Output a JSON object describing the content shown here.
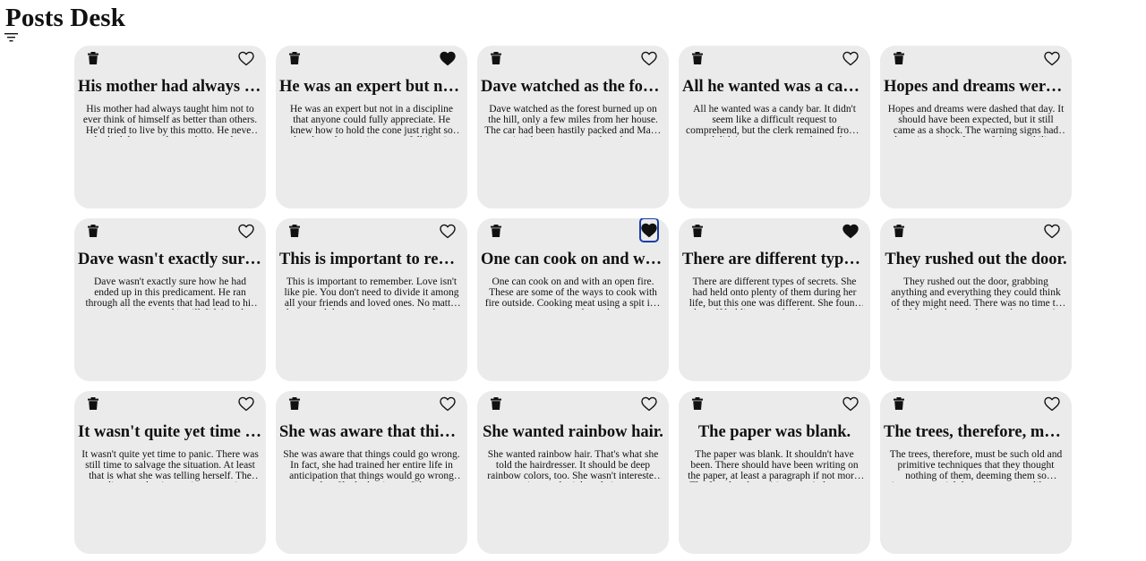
{
  "app": {
    "title": "Posts Desk"
  },
  "toolbar": {
    "filter_icon": "filter-icon"
  },
  "posts": [
    {
      "title": "His mother had always taught him",
      "body": "His mother had always taught him not to ever think of himself as better than others. He'd tried to live by this motto. He never looked down on those who were less fortunate.",
      "liked": false
    },
    {
      "title": "He was an expert but not in a discipline",
      "body": "He was an expert but not in a discipline that anyone could fully appreciate. He knew how to hold the cone just right so that the soft serve ice cream fell into it.",
      "liked": true
    },
    {
      "title": "Dave watched as the forest burned up",
      "body": "Dave watched as the forest burned up on the hill, only a few miles from her house. The car had been hastily packed and Marta was inside trying to round up the pets.",
      "liked": false
    },
    {
      "title": "All he wanted was a candy bar.",
      "body": "All he wanted was a candy bar. It didn't seem like a difficult request to comprehend, but the clerk remained frozen and didn't seem to want to honor the request.",
      "liked": false
    },
    {
      "title": "Hopes and dreams were dashed that day.",
      "body": "Hopes and dreams were dashed that day. It should have been expected, but it still came as a shock. The warning signs had been ignored in favor of the possibility.",
      "liked": false
    },
    {
      "title": "Dave wasn't exactly sure how he had",
      "body": "Dave wasn't exactly sure how he had ended up in this predicament. He ran through all the events that had lead to his current situation and it still didn't make sense.",
      "liked": false
    },
    {
      "title": "This is important to remember.",
      "body": "This is important to remember. Love isn't like pie. You don't need to divide it among all your friends and loved ones. No matter how much love you give, you can always give more.",
      "liked": false
    },
    {
      "title": "One can cook on and with an open fire.",
      "body": "One can cook on and with an open fire. These are some of the ways to cook with fire outside. Cooking meat using a spit is a great way to evenly cook meat.",
      "liked": true
    },
    {
      "title": "There are different types of secrets.",
      "body": "There are different types of secrets. She had held onto plenty of them during her life, but this one was different. She found herself holding onto the deepest secret.",
      "liked": true
    },
    {
      "title": "They rushed out the door.",
      "body": "They rushed out the door, grabbing anything and everything they could think of they might need. There was no time to double-check to make sure they weren't leaving something.",
      "liked": false
    },
    {
      "title": "It wasn't quite yet time to panic.",
      "body": "It wasn't quite yet time to panic. There was still time to salvage the situation. At least that is what she was telling herself. The reality was that it was time to panic.",
      "liked": false
    },
    {
      "title": "She was aware that things could go wrong.",
      "body": "She was aware that things could go wrong. In fact, she had trained her entire life in anticipation that things would go wrong one day. She had quiet confidence.",
      "liked": false
    },
    {
      "title": "She wanted rainbow hair.",
      "body": "She wanted rainbow hair. That's what she told the hairdresser. It should be deep rainbow colors, too. She wasn't interested in pastel rainbow hair.",
      "liked": false
    },
    {
      "title": "The paper was blank.",
      "body": "The paper was blank. It shouldn't have been. There should have been writing on the paper, at least a paragraph if not more. The fact that the writing wasn't there was frustrating.",
      "liked": false
    },
    {
      "title": "The trees, therefore, must be such old",
      "body": "The trees, therefore, must be such old and primitive techniques that they thought nothing of them, deeming them so inconsequential that even savages like us would know of them.",
      "liked": false
    }
  ],
  "focused_like_index": 7
}
